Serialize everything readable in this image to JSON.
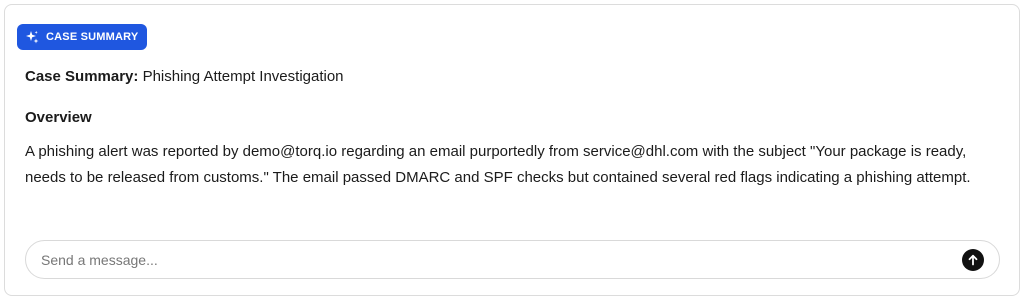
{
  "badge": {
    "label": "CASE SUMMARY",
    "icon": "sparkles-icon"
  },
  "summary": {
    "key": "Case Summary:",
    "value": "Phishing Attempt Investigation"
  },
  "overview": {
    "heading": "Overview",
    "body_before_email": "A phishing alert was reported by ",
    "reporter_email": "demo@torq.io",
    "body_after_email": " regarding an email purportedly from service@dhl.com with the subject \"Your package is ready, needs to be released from customs.\" The email passed DMARC and SPF checks but contained several red flags indicating a phishing attempt."
  },
  "message_input": {
    "placeholder": "Send a message...",
    "value": ""
  },
  "send_button": {
    "icon": "arrow-up-icon"
  },
  "colors": {
    "accent": "#1f57e0",
    "send": "#111111"
  }
}
